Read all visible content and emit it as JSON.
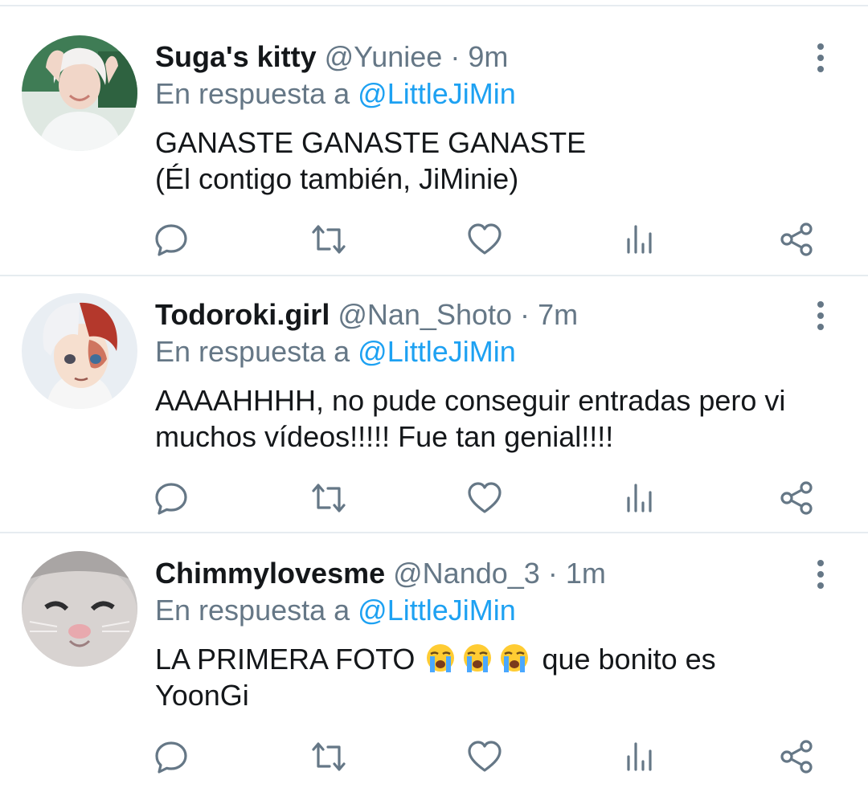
{
  "reply_prefix": "En respuesta a",
  "colors": {
    "text_primary": "#14171a",
    "text_secondary": "#657786",
    "mention": "#1da1f2",
    "divider": "#e6ecf0"
  },
  "action_icons": [
    "reply-icon",
    "retweet-icon",
    "like-icon",
    "analytics-icon",
    "share-icon"
  ],
  "tweets": [
    {
      "display_name": "Suga's kitty",
      "handle": "@Yuniee",
      "separator": "·",
      "time": "9m",
      "reply_to": "@LittleJiMin",
      "text_lines": [
        "GANASTE GANASTE GANASTE",
        "(Él contigo también, JiMinie)"
      ]
    },
    {
      "display_name": "Todoroki.girl",
      "handle": "@Nan_Shoto",
      "separator": "·",
      "time": "7m",
      "reply_to": "@LittleJiMin",
      "text_lines": [
        "AAAAHHHH, no pude conseguir entradas pero vi",
        "muchos vídeos!!!!! Fue tan genial!!!!"
      ]
    },
    {
      "display_name": "Chimmylovesme",
      "handle": "@Nando_3",
      "separator": "·",
      "time": "1m",
      "reply_to": "@LittleJiMin",
      "text_line1_before_emoji": "LA PRIMERA FOTO",
      "emojis": [
        "loudly-crying-face-emoji",
        "loudly-crying-face-emoji",
        "loudly-crying-face-emoji"
      ],
      "text_line1_after_emoji": "que bonito es",
      "text_line2": "YoonGi"
    }
  ]
}
